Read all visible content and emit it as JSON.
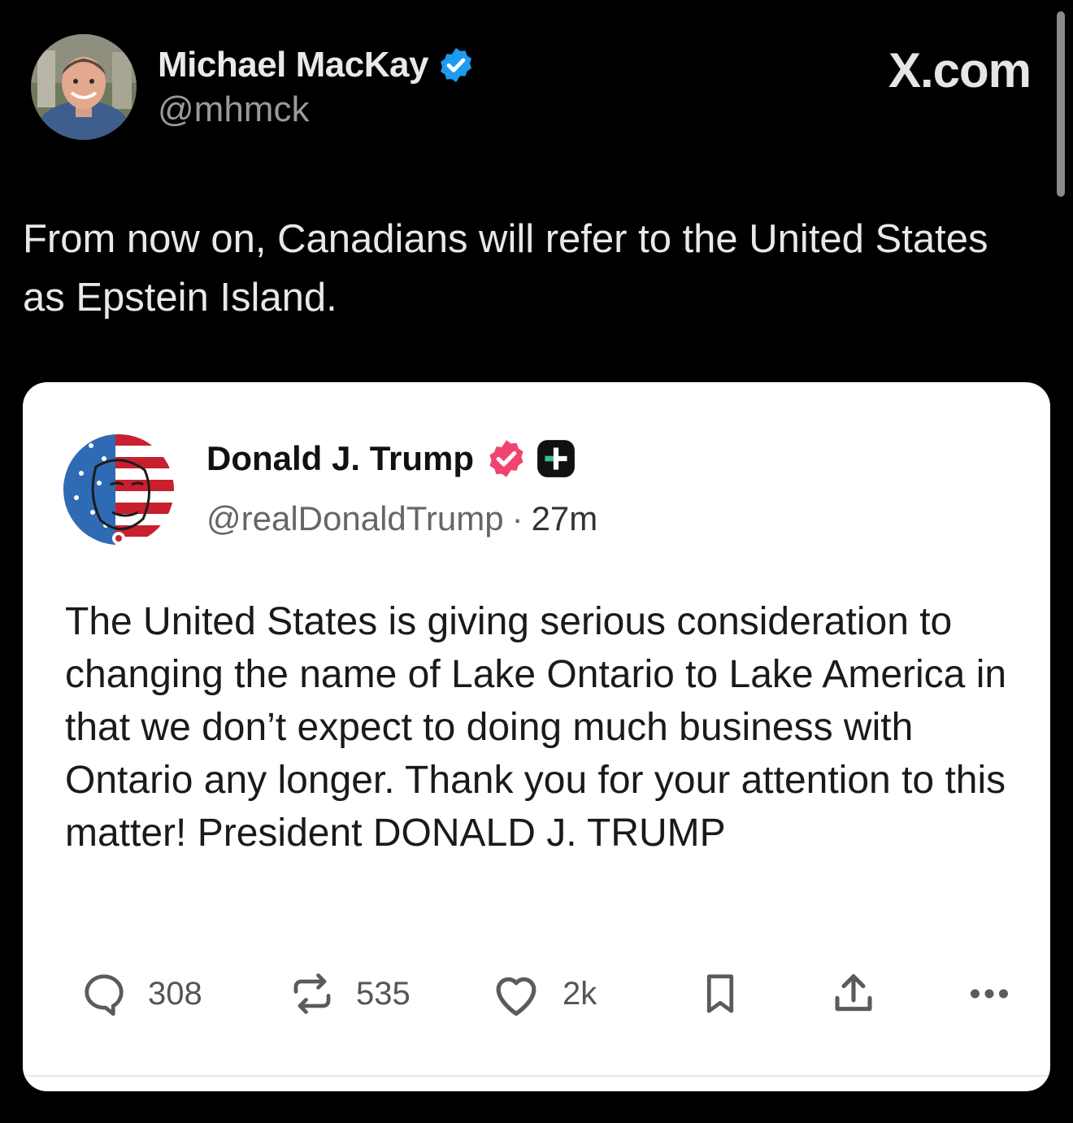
{
  "author": {
    "name": "Michael MacKay",
    "handle": "@mhmck"
  },
  "brand": "X.com",
  "tweet": {
    "text": "From now on, Canadians will refer to the United States as Epstein Island."
  },
  "quoted_post": {
    "name": "Donald J. Trump",
    "handle": "@realDonaldTrump",
    "separator": "·",
    "time": "27m",
    "text": "The United States is giving serious consideration to changing the name of Lake Ontario to Lake America in that we don’t expect to doing much business with Ontario any longer. Thank you for your attention to this matter! President DONALD J. TRUMP",
    "counts": {
      "replies": "308",
      "reposts": "535",
      "likes": "2k"
    }
  },
  "colors": {
    "background": "#000000",
    "verified_blue": "#1d9bf0",
    "verified_pink": "#f0436e",
    "card_background": "#ffffff"
  },
  "icons": [
    "verified-badge-icon",
    "verified-pink-badge-icon",
    "plus-badge-icon",
    "reply-icon",
    "repost-icon",
    "like-icon",
    "bookmark-icon",
    "share-icon",
    "more-icon"
  ]
}
